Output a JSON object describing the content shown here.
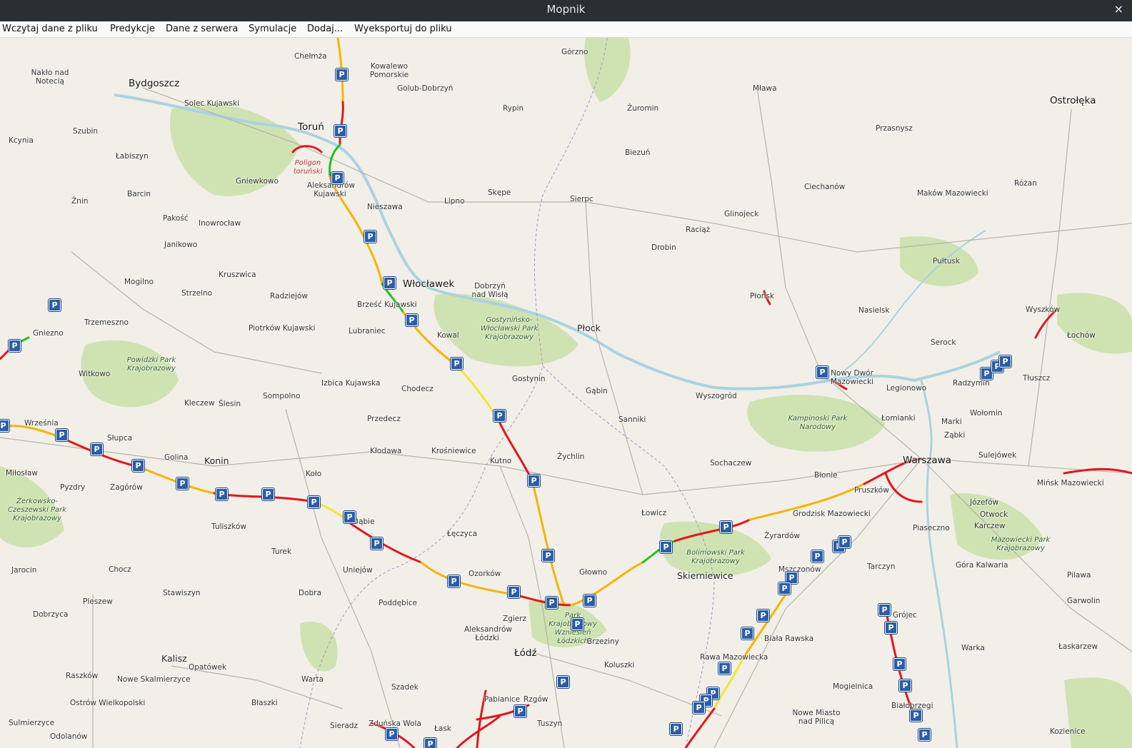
{
  "window": {
    "title": "Mopnik",
    "close_icon": "×"
  },
  "menu": [
    {
      "label": "Wczytaj dane z pliku"
    },
    {
      "label": "Predykcje"
    },
    {
      "label": "Dane z serwera"
    },
    {
      "label": "Symulacje"
    },
    {
      "label": "Dodaj..."
    },
    {
      "label": "Wyeksportuj do pliku"
    }
  ],
  "map": {
    "parking_marker_text": "P",
    "places": [
      "Chełmża",
      "Kowalewo Pomorskie",
      "Golub-Dobrzyń",
      "Górzno",
      "Nakło nad Notecią",
      "Bydgoszcz",
      "Solec Kujawski",
      "Toruń",
      "Rypin",
      "Żuromin",
      "Mława",
      "Przasnysz",
      "Ostrołęka",
      "Szubin",
      "Kcynia",
      "Łabiszyn",
      "Biezuń",
      "Gniewkowo",
      "Aleksandrów Kujawski",
      "Skępe",
      "Lipno",
      "Sierpc",
      "Ciechanów",
      "Maków Mazowiecki",
      "Różan",
      "Barcin",
      "Żnin",
      "Pakość",
      "Inowrocław",
      "Nieszawa",
      "Glinojeck",
      "Raciąż",
      "Janikowo",
      "Drobin",
      "Pułtusk",
      "Kruszwica",
      "Mogilno",
      "Strzelno",
      "Radziejów",
      "Włocławek",
      "Dobrzyń nad Wisłą",
      "Płońsk",
      "Nasielsk",
      "Wyszków",
      "Brześć Kujawski",
      "Trzemeszno",
      "Piotrków Kujawski",
      "Lubraniec",
      "Kowal",
      "Płock",
      "Serock",
      "Łochów",
      "Gniezno",
      "Witkowo",
      "Izbica Kujawska",
      "Chodecz",
      "Gostynin",
      "Gąbin",
      "Nowy Dwór Mazowiecki",
      "Legionowo",
      "Radzymin",
      "Tłuszcz",
      "Września",
      "Sompolno",
      "Kleczew",
      "Ślesin",
      "Przedecz",
      "Sanniki",
      "Wyszogród",
      "Łomianki",
      "Marki",
      "Wołomin",
      "Słupca",
      "Golina",
      "Konin",
      "Kłodawa",
      "Krośniewice",
      "Kutno",
      "Żychlin",
      "Sochaczew",
      "Błonie",
      "Warszawa",
      "Ząbki",
      "Sulejówek",
      "Miłosław",
      "Pyzdry",
      "Zagórów",
      "Koło",
      "Dąbie",
      "Pruszków",
      "Mińsk Mazowiecki",
      "Łowicz",
      "Grodzisk Mazowiecki",
      "Józefów",
      "Otwock",
      "Tuliszków",
      "Łęczyca",
      "Żyrardów",
      "Piaseczno",
      "Karczew",
      "Turek",
      "Uniejów",
      "Głowno",
      "Skierniewice",
      "Mszczonów",
      "Tarczyn",
      "Góra Kalwaria",
      "Pilawa",
      "Jarocin",
      "Chocz",
      "Ozorków",
      "Stawiszyn",
      "Dobra",
      "Poddębice",
      "Zgierz",
      "Garwolin",
      "Pleszew",
      "Brzeziny",
      "Biała Rawska",
      "Dobrzyca",
      "Aleksandrów Łódzki",
      "Łódź",
      "Warka",
      "Łaskarzew",
      "Kalisz",
      "Opatówek",
      "Koluszki",
      "Rawa Mazowiecka",
      "Warta",
      "Raszków",
      "Nowe Skalmierzyce",
      "Szadek",
      "Pabianice",
      "Rzgów",
      "Mogielnica",
      "Ostrów Wielkopolski",
      "Błaszki",
      "Sieradz",
      "Zduńska Wola",
      "Łask",
      "Tuszyn",
      "Nowe Miasto nad Pilicą",
      "Białobrzegi",
      "Sulmierzyce",
      "Odolanów",
      "Kozienice",
      "Grójec"
    ],
    "areas": [
      "Poligon toruński",
      "Gostynińsko-Włocławski Park Krajobrazowy",
      "Powidzki Park Krajobrazowy",
      "Kampinoski Park Narodowy",
      "Żerkowsko-Czeszewski Park Krajobrazowy",
      "Bolimowski Park Krajobrazowy",
      "Park Krajobrazowy Wzniesień Łódzkich",
      "Mazowiecki Park Krajobrazowy"
    ],
    "colors": {
      "traffic_green": "#22c01f",
      "traffic_yellow": "#f5e52d",
      "traffic_orange": "#f5b400",
      "traffic_red": "#e3161b",
      "parking": "#2a5ea8",
      "forest": "#c8dfa8",
      "water": "#aad3df"
    }
  }
}
